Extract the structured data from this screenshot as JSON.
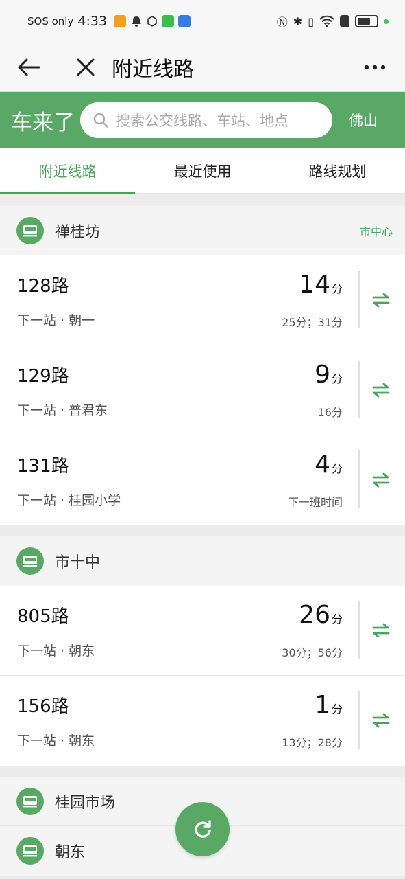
{
  "status_bar": {
    "sos": "SOS only",
    "time": "4:33"
  },
  "nav": {
    "title": "附近线路"
  },
  "header": {
    "brand": "车来了",
    "search_placeholder": "搜索公交线路、车站、地点",
    "city": "佛山"
  },
  "tabs": [
    {
      "label": "附近线路",
      "active": true
    },
    {
      "label": "最近使用",
      "active": false
    },
    {
      "label": "路线规划",
      "active": false
    }
  ],
  "stops": [
    {
      "name": "禅桂坊",
      "tag": "市中心",
      "routes": [
        {
          "name": "128路",
          "next": "下一站 · 朝一",
          "eta": "14",
          "unit": "分",
          "sub": "25分；31分"
        },
        {
          "name": "129路",
          "next": "下一站 · 普君东",
          "eta": "9",
          "unit": "分",
          "sub": "16分"
        },
        {
          "name": "131路",
          "next": "下一站 · 桂园小学",
          "eta": "4",
          "unit": "分",
          "sub": "下一班时间"
        }
      ]
    },
    {
      "name": "市十中",
      "routes": [
        {
          "name": "805路",
          "next": "下一站 · 朝东",
          "eta": "26",
          "unit": "分",
          "sub": "30分；56分"
        },
        {
          "name": "156路",
          "next": "下一站 · 朝东",
          "eta": "1",
          "unit": "分",
          "sub": "13分；28分"
        }
      ]
    },
    {
      "name": "桂园市场"
    },
    {
      "name": "朝东"
    }
  ],
  "colors": {
    "brand_green": "#5aa866",
    "accent_green": "#4aa55c"
  }
}
